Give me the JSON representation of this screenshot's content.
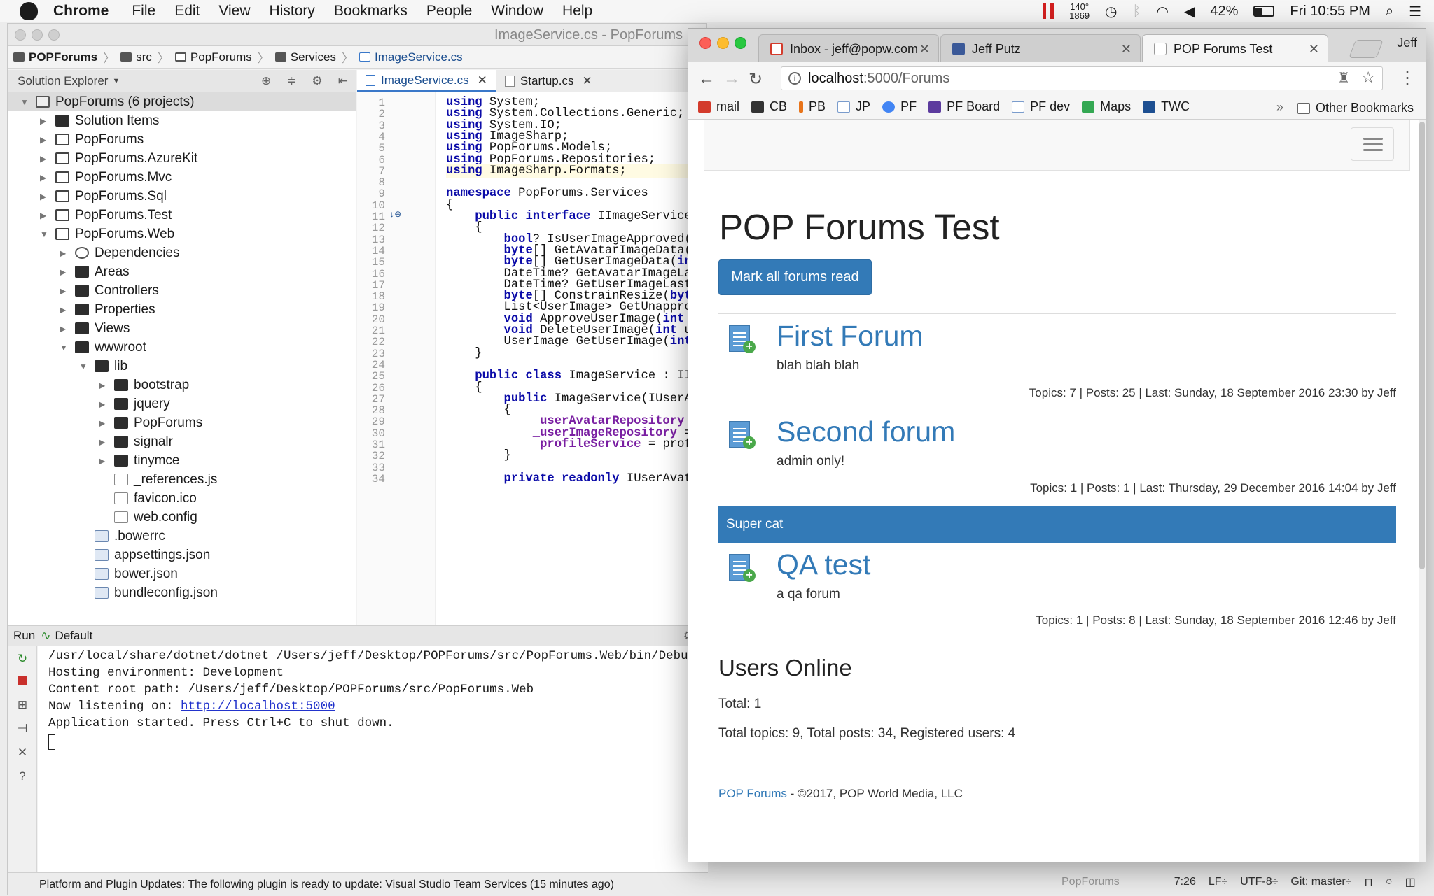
{
  "menubar": {
    "app": "Chrome",
    "items": [
      "File",
      "Edit",
      "View",
      "History",
      "Bookmarks",
      "People",
      "Window",
      "Help"
    ],
    "cpu_top": "140°",
    "cpu_bottom": "1869",
    "battery": "42%",
    "clock": "Fri 10:55 PM"
  },
  "ide": {
    "title": "ImageService.cs - PopForums",
    "breadcrumbs": [
      "POPForums",
      "src",
      "PopForums",
      "Services",
      "ImageService.cs"
    ],
    "solution_explorer_label": "Solution Explorer",
    "tree": [
      {
        "label": "PopForums (6 projects)",
        "icon": "solution-icon",
        "level": 0,
        "expanded": true
      },
      {
        "label": "Solution Items",
        "icon": "folder-icon",
        "level": 1,
        "expanded": false
      },
      {
        "label": "PopForums",
        "icon": "project-icon",
        "level": 1,
        "expanded": false
      },
      {
        "label": "PopForums.AzureKit",
        "icon": "project-icon",
        "level": 1,
        "expanded": false
      },
      {
        "label": "PopForums.Mvc",
        "icon": "project-icon",
        "level": 1,
        "expanded": false
      },
      {
        "label": "PopForums.Sql",
        "icon": "project-icon",
        "level": 1,
        "expanded": false
      },
      {
        "label": "PopForums.Test",
        "icon": "project-icon",
        "level": 1,
        "expanded": false
      },
      {
        "label": "PopForums.Web",
        "icon": "project-icon",
        "level": 1,
        "expanded": true
      },
      {
        "label": "Dependencies",
        "icon": "dependencies-icon",
        "level": 2,
        "expanded": false
      },
      {
        "label": "Areas",
        "icon": "folder-icon",
        "level": 2,
        "expanded": false
      },
      {
        "label": "Controllers",
        "icon": "folder-icon",
        "level": 2,
        "expanded": false
      },
      {
        "label": "Properties",
        "icon": "folder-icon",
        "level": 2,
        "expanded": false
      },
      {
        "label": "Views",
        "icon": "folder-icon",
        "level": 2,
        "expanded": false
      },
      {
        "label": "wwwroot",
        "icon": "folder-icon",
        "level": 2,
        "expanded": true
      },
      {
        "label": "lib",
        "icon": "folder-icon",
        "level": 3,
        "expanded": true
      },
      {
        "label": "bootstrap",
        "icon": "folder-icon",
        "level": 4,
        "expanded": false
      },
      {
        "label": "jquery",
        "icon": "folder-icon",
        "level": 4,
        "expanded": false
      },
      {
        "label": "PopForums",
        "icon": "folder-icon",
        "level": 4,
        "expanded": false
      },
      {
        "label": "signalr",
        "icon": "folder-icon",
        "level": 4,
        "expanded": false
      },
      {
        "label": "tinymce",
        "icon": "folder-icon",
        "level": 4,
        "expanded": false
      },
      {
        "label": "_references.js",
        "icon": "file-icon",
        "level": 4
      },
      {
        "label": "favicon.ico",
        "icon": "file-icon",
        "level": 4
      },
      {
        "label": "web.config",
        "icon": "file-icon",
        "level": 4
      },
      {
        "label": ".bowerrc",
        "icon": "json-icon",
        "level": 3
      },
      {
        "label": "appsettings.json",
        "icon": "json-icon",
        "level": 3
      },
      {
        "label": "bower.json",
        "icon": "json-icon",
        "level": 3
      },
      {
        "label": "bundleconfig.json",
        "icon": "json-icon",
        "level": 3
      }
    ],
    "tabs": [
      {
        "label": "ImageService.cs",
        "active": true
      },
      {
        "label": "Startup.cs",
        "active": false
      }
    ],
    "code": [
      "using System;",
      "using System.Collections.Generic;",
      "using System.IO;",
      "using ImageSharp;",
      "using PopForums.Models;",
      "using PopForums.Repositories;",
      "using ImageSharp.Formats;",
      "",
      "namespace PopForums.Services",
      "{",
      "    public interface IImageService",
      "    {",
      "        bool? IsUserImageApproved(in",
      "        byte[] GetAvatarImageData(in",
      "        byte[] GetUserImageData(int ",
      "        DateTime? GetAvatarImageLast",
      "        DateTime? GetUserImageLastMo",
      "        byte[] ConstrainResize(byte[",
      "        List<UserImage> GetUnapprove",
      "        void ApproveUserImage(int us",
      "        void DeleteUserImage(int use",
      "        UserImage GetUserImage(int u",
      "    }",
      "",
      "    public class ImageService : IIma",
      "    {",
      "        public ImageService(IUserAva",
      "        {",
      "            _userAvatarRepository = ",
      "            _userImageRepository = u",
      "            _profileService = profil",
      "        }",
      "",
      "        private readonly IUserAvatar"
    ],
    "run": {
      "label": "Run",
      "config": "Default",
      "lines": [
        "/usr/local/share/dotnet/dotnet /Users/jeff/Desktop/POPForums/src/PopForums.Web/bin/Debug/netc",
        "Hosting environment: Development",
        "Content root path: /Users/jeff/Desktop/POPForums/src/PopForums.Web",
        "Now listening on: ",
        "Application started. Press Ctrl+C to shut down."
      ],
      "link": "http://localhost:5000"
    },
    "status": {
      "message": "Platform and Plugin Updates: The following plugin is ready to update: Visual Studio Team Services (15 minutes ago)",
      "project": "PopForums",
      "position": "7:26",
      "line_ending": "LF÷",
      "encoding": "UTF-8÷",
      "branch": "Git: master÷"
    }
  },
  "chrome": {
    "user": "Jeff",
    "tabs": [
      {
        "label": "Inbox - jeff@popw.com -",
        "favicon": "gmail-icon",
        "active": false
      },
      {
        "label": "Jeff Putz",
        "favicon": "facebook-icon",
        "active": false
      },
      {
        "label": "POP Forums Test",
        "favicon": "page-icon",
        "active": true
      }
    ],
    "url_host": "localhost",
    "url_rest": ":5000/Forums",
    "bookmarks": [
      {
        "label": "mail",
        "color": "#d33b2c"
      },
      {
        "label": "CB",
        "color": "#333333"
      },
      {
        "label": "PB",
        "color": "#e8741a"
      },
      {
        "label": "JP",
        "color": "#7a9ccc"
      },
      {
        "label": "PF",
        "color": "#4285f4"
      },
      {
        "label": "PF Board",
        "color": "#5c3b9e"
      },
      {
        "label": "PF dev",
        "color": "#7a9ccc"
      },
      {
        "label": "Maps",
        "color": "#34a853"
      },
      {
        "label": "TWC",
        "color": "#1d4f91"
      }
    ],
    "other_bookmarks": "Other Bookmarks"
  },
  "forum_page": {
    "title": "POP Forums Test",
    "mark_read_button": "Mark all forums read",
    "forums": [
      {
        "name": "First Forum",
        "description": "blah blah blah",
        "stats": "Topics: 7 | Posts: 25 | Last: Sunday, 18 September 2016 23:30 by Jeff"
      },
      {
        "name": "Second forum",
        "description": "admin only!",
        "stats": "Topics: 1 | Posts: 1 | Last: Thursday, 29 December 2016 14:04 by Jeff"
      },
      {
        "name": "QA test",
        "description": "a qa forum",
        "stats": "Topics: 1 | Posts: 8 | Last: Sunday, 18 September 2016 12:46 by Jeff"
      }
    ],
    "category": "Super cat",
    "users_online_heading": "Users Online",
    "users_total": "Total: 1",
    "totals": "Total topics: 9, Total posts: 34, Registered users: 4",
    "footer_link": "POP Forums",
    "footer_text": " - ©2017, POP World Media, LLC"
  },
  "colors": {
    "link": "#337ab7",
    "category_bar": "#337ab7"
  }
}
